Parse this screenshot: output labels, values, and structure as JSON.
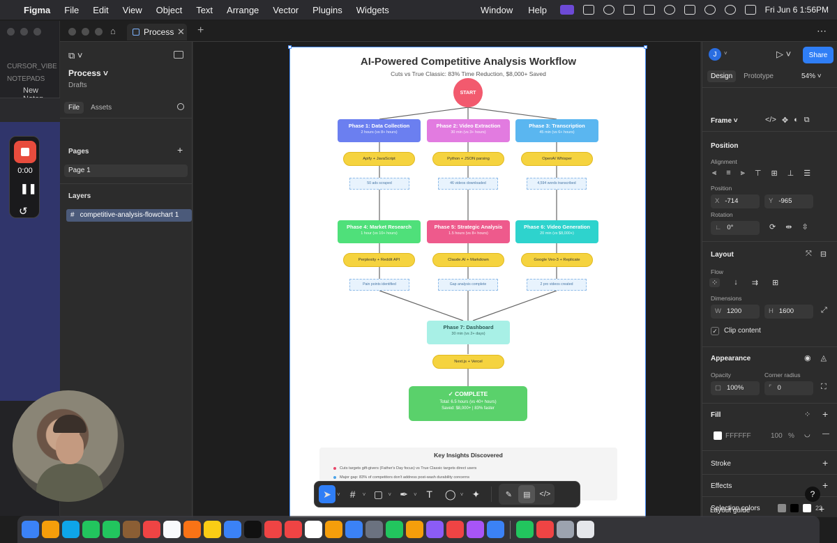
{
  "menubar": {
    "app_name": "Figma",
    "menus": [
      "File",
      "Edit",
      "View",
      "Object",
      "Text",
      "Arrange",
      "Vector",
      "Plugins",
      "Widgets"
    ],
    "center_menus": [
      "Window",
      "Help"
    ],
    "clock": "Fri Jun 6  1:56PM"
  },
  "background_window": {
    "item1": "CURSOR_VIBE",
    "item2": "NOTEPADS",
    "item3": "New Notep"
  },
  "recorder": {
    "time": "0:00"
  },
  "titlebar": {
    "tab_label": "Process"
  },
  "left_panel": {
    "file_title": "Process",
    "file_subtitle": "Drafts",
    "tabs": [
      "File",
      "Assets"
    ],
    "pages_heading": "Pages",
    "page_item": "Page 1",
    "layers_heading": "Layers",
    "layer_item": "competitive-analysis-flowchart 1"
  },
  "flowchart": {
    "title": "AI-Powered Competitive Analysis Workflow",
    "subtitle": "Cuts vs True Classic: 83% Time Reduction, $8,000+ Saved",
    "start": "START",
    "phases": [
      {
        "title": "Phase 1: Data Collection",
        "sub": "2 hours (vs 8+ hours)",
        "color": "#6b7ff0"
      },
      {
        "title": "Phase 2: Video Extraction",
        "sub": "30 min (vs 3+ hours)",
        "color": "#e27be0"
      },
      {
        "title": "Phase 3: Transcription",
        "sub": "45 min (vs 6+ hours)",
        "color": "#5ab6f0"
      },
      {
        "title": "Phase 4: Market Research",
        "sub": "1 hour (vs 10+ hours)",
        "color": "#4fe07a"
      },
      {
        "title": "Phase 5: Strategic Analysis",
        "sub": "1.5 hours (vs 8+ hours)",
        "color": "#ee5a8c"
      },
      {
        "title": "Phase 6: Video Generation",
        "sub": "20 min (vs $8,000+)",
        "color": "#2ed3cd"
      }
    ],
    "tools": [
      "Apify + JavaScript",
      "Python + JSON parsing",
      "OpenAI Whisper",
      "Perplexity + Reddit API",
      "Claude.AI + Markdown",
      "Google Veo-3 + Replicate"
    ],
    "results": [
      "50 ads scraped",
      "46 videos downloaded",
      "4,594 words transcribed",
      "Pain points identified",
      "Gap analysis complete",
      "2 pro videos created"
    ],
    "dashboard": {
      "title": "Phase 7: Dashboard",
      "sub": "30 min (vs 2+ days)",
      "tool": "Next.js + Vercel"
    },
    "complete": {
      "title": "✓ COMPLETE",
      "line1": "Total: 6.5 hours (vs 40+ hours)",
      "line2": "Saved: $8,000+ | 83% faster"
    },
    "insights": {
      "title": "Key Insights Discovered",
      "items": [
        "Cuts targets gift-givers (Father's Day focus) vs True Classic targets direct users",
        "Major gap: 83% of competitors don't address post-wash durability concerns"
      ]
    }
  },
  "right_panel": {
    "avatar_letter": "J",
    "share": "Share",
    "modes": [
      "Design",
      "Prototype"
    ],
    "zoom": "54%",
    "frame_label": "Frame",
    "position_heading": "Position",
    "alignment_label": "Alignment",
    "position_label": "Position",
    "x_key": "X",
    "x_val": "-714",
    "y_key": "Y",
    "y_val": "-965",
    "rotation_label": "Rotation",
    "rotation_val": "0°",
    "layout_heading": "Layout",
    "flow_label": "Flow",
    "dimensions_label": "Dimensions",
    "w_key": "W",
    "w_val": "1200",
    "h_key": "H",
    "h_val": "1600",
    "clip_content": "Clip content",
    "appearance_heading": "Appearance",
    "opacity_label": "Opacity",
    "opacity_val": "100%",
    "corner_label": "Corner radius",
    "corner_val": "0",
    "fill_heading": "Fill",
    "fill_hex": "FFFFFF",
    "fill_opacity": "100",
    "fill_pct": "%",
    "stroke_heading": "Stroke",
    "effects_heading": "Effects",
    "selection_colors": "Selection colors",
    "selection_count": "23",
    "layout_guide": "Layout guide"
  },
  "dock": {
    "colors": [
      "#3b82f6",
      "#f59e0b",
      "#0ea5e9",
      "#22c55e",
      "#22c55e",
      "#8b5e34",
      "#ef4444",
      "#f8fafc",
      "#f97316",
      "#facc15",
      "#3b82f6",
      "#111111",
      "#ef4444",
      "#ef4444",
      "#ffffff",
      "#f59e0b",
      "#3b82f6",
      "#6b7280",
      "#22c55e",
      "#f59e0b",
      "#8b5cf6",
      "#ef4444",
      "#a855f7",
      "#3b82f6",
      "#22c55e",
      "#ef4444",
      "#9ca3af",
      "#e5e7eb"
    ]
  }
}
